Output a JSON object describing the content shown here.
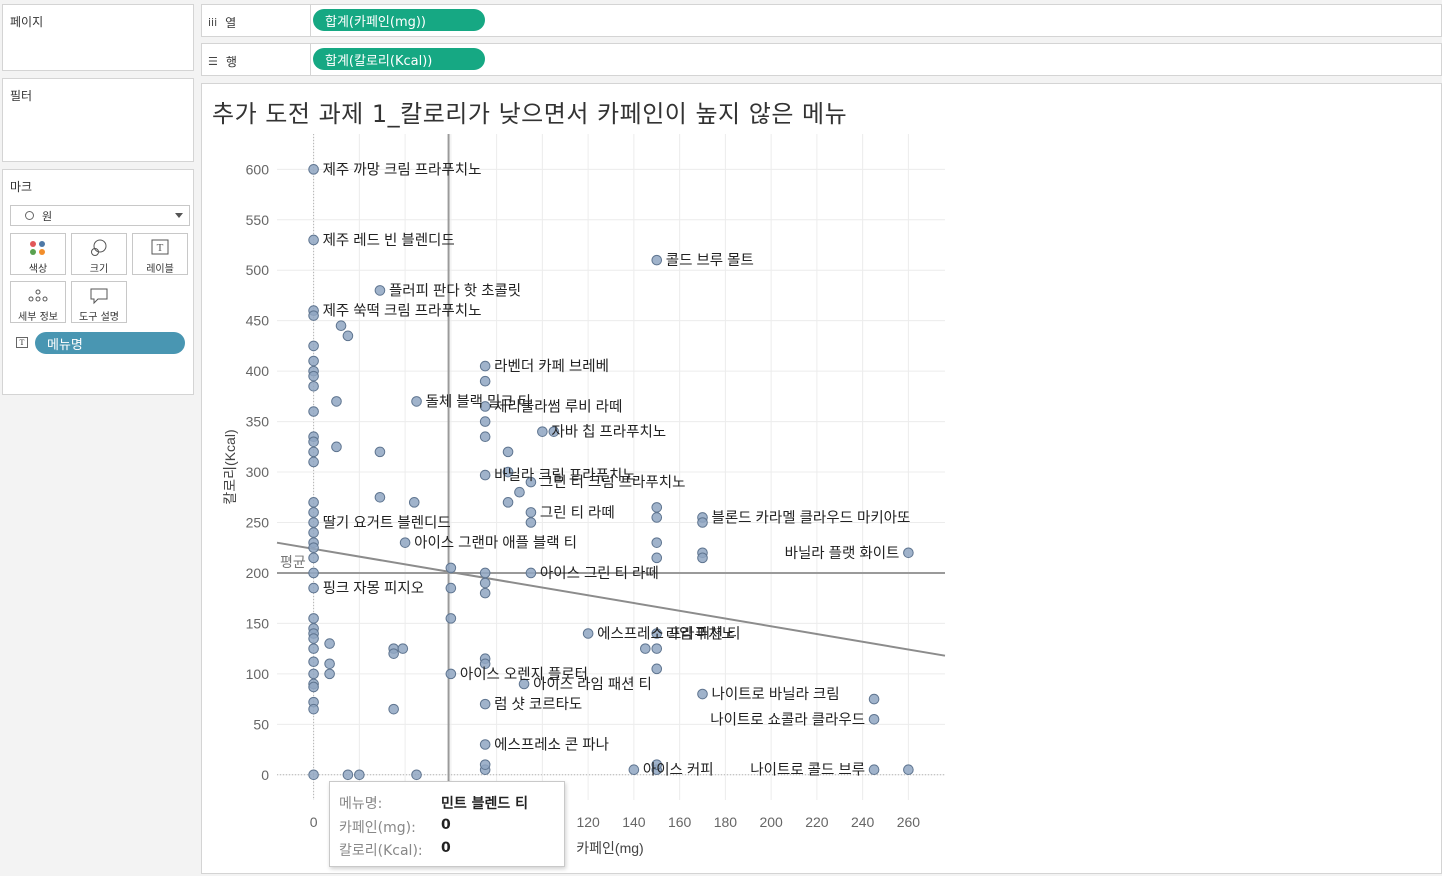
{
  "shelves": {
    "pages_title": "페이지",
    "filters_title": "필터",
    "marks_title": "마크",
    "mark_type": "원",
    "columns_label": "열",
    "rows_label": "행",
    "columns_pill": "합계(카페인(mg))",
    "rows_pill": "합계(칼로리(Kcal))",
    "mark_buttons": {
      "color": "색상",
      "size": "크기",
      "label": "레이블",
      "detail": "세부 정보",
      "tooltip": "도구 설명"
    },
    "label_pill": "메뉴명"
  },
  "colors": {
    "pill_teal": "#16a883",
    "pill_blue": "#4996b2",
    "point_fill": "#8fa6c2",
    "point_stroke": "#5f7590",
    "trend_line": "#8c8c8c"
  },
  "sheet_title": "추가 도전 과제 1_칼로리가 낮으면서 카페인이 높지 않은 메뉴",
  "tooltip": {
    "k1": "메뉴명:",
    "v1": "민트 블렌드 티",
    "k2": "카페인(mg):",
    "v2": "0",
    "k3": "칼로리(Kcal):",
    "v3": "0"
  },
  "chart_data": {
    "type": "scatter",
    "xlabel": "카페인(mg)",
    "ylabel": "칼로리(Kcal)",
    "x_ticks": [
      0,
      20,
      40,
      60,
      80,
      100,
      120,
      140,
      160,
      180,
      200,
      220,
      240,
      260
    ],
    "y_ticks": [
      0,
      50,
      100,
      150,
      200,
      250,
      300,
      350,
      400,
      450,
      500,
      550,
      600
    ],
    "xlim": [
      -16,
      276
    ],
    "ylim": [
      -25,
      635
    ],
    "reference_lines": {
      "x_mean": 59,
      "y_mean": 200,
      "label": "평균"
    },
    "trend_line": {
      "from": [
        -16,
        230
      ],
      "to": [
        276,
        118
      ]
    },
    "points": [
      {
        "x": 0,
        "y": 600,
        "label": "제주 까망 크림 프라푸치노"
      },
      {
        "x": 0,
        "y": 530,
        "label": "제주 레드 빈 블렌디드"
      },
      {
        "x": 150,
        "y": 510,
        "label": "콜드 브루 몰트"
      },
      {
        "x": 29,
        "y": 480,
        "label": "플러피 판다 핫 초콜릿"
      },
      {
        "x": 0,
        "y": 460,
        "label": "제주 쑥떡 크림 프라푸치노"
      },
      {
        "x": 75,
        "y": 405,
        "label": "라벤더 카페 브레베"
      },
      {
        "x": 75,
        "y": 365,
        "label": "체리블라썸 루비 라떼"
      },
      {
        "x": 45,
        "y": 370,
        "label": "돌체 블랙 밀크 티"
      },
      {
        "x": 100,
        "y": 340,
        "label": "자바 칩 프라푸치노"
      },
      {
        "x": 75,
        "y": 297,
        "label": "바닐라 크림 프라푸치노"
      },
      {
        "x": 95,
        "y": 290,
        "label": "그린 티 크림 프라푸치노"
      },
      {
        "x": 95,
        "y": 260,
        "label": "그린 티 라떼"
      },
      {
        "x": 170,
        "y": 255,
        "label": "블론드 카라멜 클라우드 마키아또"
      },
      {
        "x": 0,
        "y": 250,
        "label": "딸기 요거트 블렌디드"
      },
      {
        "x": 40,
        "y": 230,
        "label": "아이스 그랜마 애플 블랙 티"
      },
      {
        "x": 260,
        "y": 220,
        "label": "바닐라 플랫 화이트"
      },
      {
        "x": 95,
        "y": 200,
        "label": "아이스 그린 티 라떼"
      },
      {
        "x": 0,
        "y": 185,
        "label": "핑크 자몽 피지오"
      },
      {
        "x": 120,
        "y": 140,
        "label": "에스프레소 프라푸치노"
      },
      {
        "x": 150,
        "y": 140,
        "label": "라임 패션 티"
      },
      {
        "x": 92,
        "y": 90,
        "label": "아이스 라임 패션 티"
      },
      {
        "x": 60,
        "y": 100,
        "label": "아이스 오렌지 플로터"
      },
      {
        "x": 170,
        "y": 80,
        "label": "나이트로 바닐라 크림"
      },
      {
        "x": 245,
        "y": 75,
        "label": ""
      },
      {
        "x": 75,
        "y": 70,
        "label": "럼 샷 코르타도"
      },
      {
        "x": 245,
        "y": 55,
        "label": "나이트로 쇼콜라 클라우드"
      },
      {
        "x": 75,
        "y": 30,
        "label": "에스프레소 콘 파나"
      },
      {
        "x": 140,
        "y": 5,
        "label": "아이스 커피"
      },
      {
        "x": 245,
        "y": 5,
        "label": "나이트로 콜드 브루"
      },
      {
        "x": 260,
        "y": 5,
        "label": ""
      },
      {
        "x": 0,
        "y": 0,
        "label": ""
      },
      {
        "x": 15,
        "y": 0,
        "label": ""
      },
      {
        "x": 20,
        "y": 0,
        "label": ""
      },
      {
        "x": 45,
        "y": 0,
        "label": ""
      },
      {
        "x": 75,
        "y": 5,
        "label": ""
      },
      {
        "x": 75,
        "y": 10,
        "label": ""
      },
      {
        "x": 150,
        "y": 5,
        "label": ""
      },
      {
        "x": 150,
        "y": 10,
        "label": ""
      },
      {
        "x": 12,
        "y": 445,
        "label": ""
      },
      {
        "x": 15,
        "y": 435,
        "label": ""
      },
      {
        "x": 0,
        "y": 455,
        "label": ""
      },
      {
        "x": 0,
        "y": 425,
        "label": ""
      },
      {
        "x": 0,
        "y": 410,
        "label": ""
      },
      {
        "x": 0,
        "y": 400,
        "label": ""
      },
      {
        "x": 0,
        "y": 395,
        "label": ""
      },
      {
        "x": 0,
        "y": 385,
        "label": ""
      },
      {
        "x": 0,
        "y": 360,
        "label": ""
      },
      {
        "x": 0,
        "y": 335,
        "label": ""
      },
      {
        "x": 0,
        "y": 330,
        "label": ""
      },
      {
        "x": 0,
        "y": 320,
        "label": ""
      },
      {
        "x": 0,
        "y": 310,
        "label": ""
      },
      {
        "x": 0,
        "y": 270,
        "label": ""
      },
      {
        "x": 0,
        "y": 260,
        "label": ""
      },
      {
        "x": 0,
        "y": 240,
        "label": ""
      },
      {
        "x": 0,
        "y": 230,
        "label": ""
      },
      {
        "x": 0,
        "y": 225,
        "label": ""
      },
      {
        "x": 0,
        "y": 215,
        "label": ""
      },
      {
        "x": 0,
        "y": 200,
        "label": ""
      },
      {
        "x": 0,
        "y": 155,
        "label": ""
      },
      {
        "x": 0,
        "y": 145,
        "label": ""
      },
      {
        "x": 0,
        "y": 140,
        "label": ""
      },
      {
        "x": 0,
        "y": 135,
        "label": ""
      },
      {
        "x": 0,
        "y": 125,
        "label": ""
      },
      {
        "x": 0,
        "y": 112,
        "label": ""
      },
      {
        "x": 0,
        "y": 100,
        "label": ""
      },
      {
        "x": 0,
        "y": 90,
        "label": ""
      },
      {
        "x": 0,
        "y": 87,
        "label": ""
      },
      {
        "x": 0,
        "y": 72,
        "label": ""
      },
      {
        "x": 0,
        "y": 65,
        "label": ""
      },
      {
        "x": 10,
        "y": 370,
        "label": ""
      },
      {
        "x": 10,
        "y": 325,
        "label": ""
      },
      {
        "x": 29,
        "y": 320,
        "label": ""
      },
      {
        "x": 29,
        "y": 275,
        "label": ""
      },
      {
        "x": 44,
        "y": 270,
        "label": ""
      },
      {
        "x": 7,
        "y": 130,
        "label": ""
      },
      {
        "x": 7,
        "y": 110,
        "label": ""
      },
      {
        "x": 7,
        "y": 100,
        "label": ""
      },
      {
        "x": 35,
        "y": 125,
        "label": ""
      },
      {
        "x": 35,
        "y": 120,
        "label": ""
      },
      {
        "x": 39,
        "y": 125,
        "label": ""
      },
      {
        "x": 35,
        "y": 65,
        "label": ""
      },
      {
        "x": 60,
        "y": 205,
        "label": ""
      },
      {
        "x": 60,
        "y": 185,
        "label": ""
      },
      {
        "x": 60,
        "y": 155,
        "label": ""
      },
      {
        "x": 75,
        "y": 390,
        "label": ""
      },
      {
        "x": 75,
        "y": 350,
        "label": ""
      },
      {
        "x": 75,
        "y": 335,
        "label": ""
      },
      {
        "x": 85,
        "y": 320,
        "label": ""
      },
      {
        "x": 85,
        "y": 300,
        "label": ""
      },
      {
        "x": 85,
        "y": 270,
        "label": ""
      },
      {
        "x": 90,
        "y": 280,
        "label": ""
      },
      {
        "x": 95,
        "y": 250,
        "label": ""
      },
      {
        "x": 105,
        "y": 340,
        "label": ""
      },
      {
        "x": 75,
        "y": 200,
        "label": ""
      },
      {
        "x": 75,
        "y": 190,
        "label": ""
      },
      {
        "x": 75,
        "y": 180,
        "label": ""
      },
      {
        "x": 75,
        "y": 115,
        "label": ""
      },
      {
        "x": 75,
        "y": 110,
        "label": ""
      },
      {
        "x": 145,
        "y": 125,
        "label": ""
      },
      {
        "x": 150,
        "y": 125,
        "label": ""
      },
      {
        "x": 150,
        "y": 105,
        "label": ""
      },
      {
        "x": 150,
        "y": 265,
        "label": ""
      },
      {
        "x": 150,
        "y": 255,
        "label": ""
      },
      {
        "x": 150,
        "y": 230,
        "label": ""
      },
      {
        "x": 150,
        "y": 215,
        "label": ""
      },
      {
        "x": 170,
        "y": 250,
        "label": ""
      },
      {
        "x": 170,
        "y": 220,
        "label": ""
      },
      {
        "x": 170,
        "y": 215,
        "label": ""
      }
    ]
  }
}
